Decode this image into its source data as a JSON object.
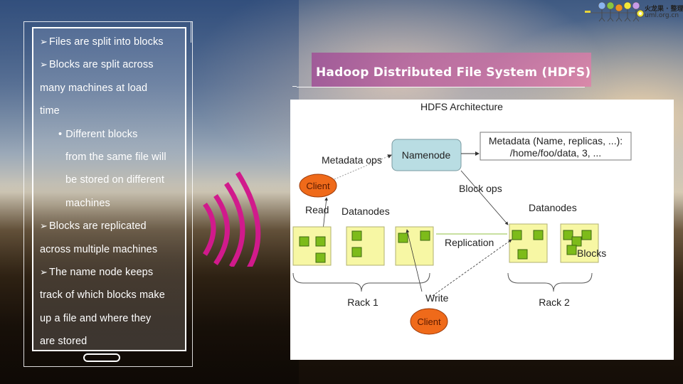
{
  "slide": {
    "title": "Hadoop Distributed File System (HDFS)",
    "title_bar_color": "#b36aa6",
    "accent_wave_color": "#d11a8c"
  },
  "logo": {
    "name_cn": "火龙果 · 整理",
    "url": "uml.org.cn",
    "figure_colors": [
      "#8ab4f0",
      "#88c540",
      "#f0901e",
      "#f3e83a",
      "#c79be8"
    ]
  },
  "phone": {
    "bullets": [
      {
        "marker": "➢",
        "lines": [
          "Files are split into blocks"
        ]
      },
      {
        "marker": "➢",
        "lines": [
          "Blocks are split across",
          "many machines at load",
          "time"
        ]
      },
      {
        "marker": "•",
        "indent": true,
        "lines": [
          "Different blocks",
          "from the same file will",
          "be stored on different",
          "machines"
        ]
      },
      {
        "marker": "➢",
        "lines": [
          "Blocks are replicated",
          "across multiple machines"
        ]
      },
      {
        "marker": "➢",
        "lines": [
          "The name node keeps",
          "track of which blocks make",
          "up a file and where they",
          "are stored"
        ]
      }
    ]
  },
  "diagram": {
    "title": "HDFS Architecture",
    "namenode": "Namenode",
    "metadata_box": [
      "Metadata (Name, replicas, ...):",
      "/home/foo/data, 3, ..."
    ],
    "labels": {
      "metadata_ops": "Metadata ops",
      "block_ops": "Block ops",
      "read": "Read",
      "write": "Write",
      "replication": "Replication",
      "blocks": "Blocks",
      "datanodes_left": "Datanodes",
      "datanodes_right": "Datanodes",
      "rack1": "Rack 1",
      "rack2": "Rack 2",
      "client_top": "Client",
      "client_bottom": "Client"
    },
    "colors": {
      "namenode_fill": "#b9dde3",
      "datanode_fill": "#f7f7a4",
      "block_fill": "#7dbb1a",
      "client_fill": "#ef6a1a"
    }
  }
}
